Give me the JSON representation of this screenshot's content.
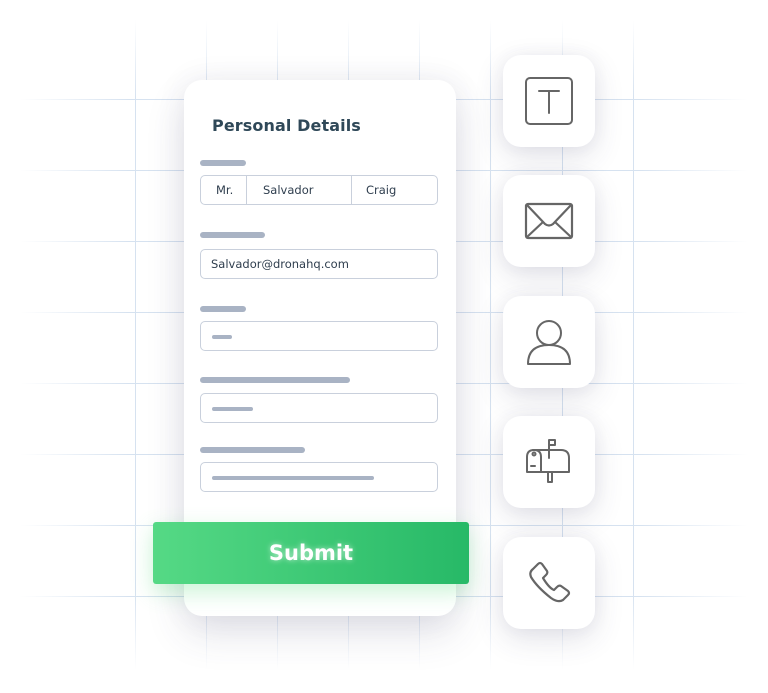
{
  "form": {
    "title": "Personal Details",
    "name_field": {
      "salutation": "Mr.",
      "first_name": "Salvador",
      "last_name": "Craig"
    },
    "email_field": {
      "value": "Salvador@dronahq.com"
    },
    "submit_label": "Submit"
  },
  "field_types": [
    {
      "icon": "text-field-icon"
    },
    {
      "icon": "email-icon"
    },
    {
      "icon": "user-icon"
    },
    {
      "icon": "mailbox-icon"
    },
    {
      "icon": "phone-icon"
    }
  ],
  "colors": {
    "accent_start": "#55d985",
    "accent_end": "#27b967",
    "title": "#2f4858",
    "placeholder_bar": "#a9b3c4",
    "icon_stroke": "#666666",
    "grid": "#d6e2f0"
  }
}
